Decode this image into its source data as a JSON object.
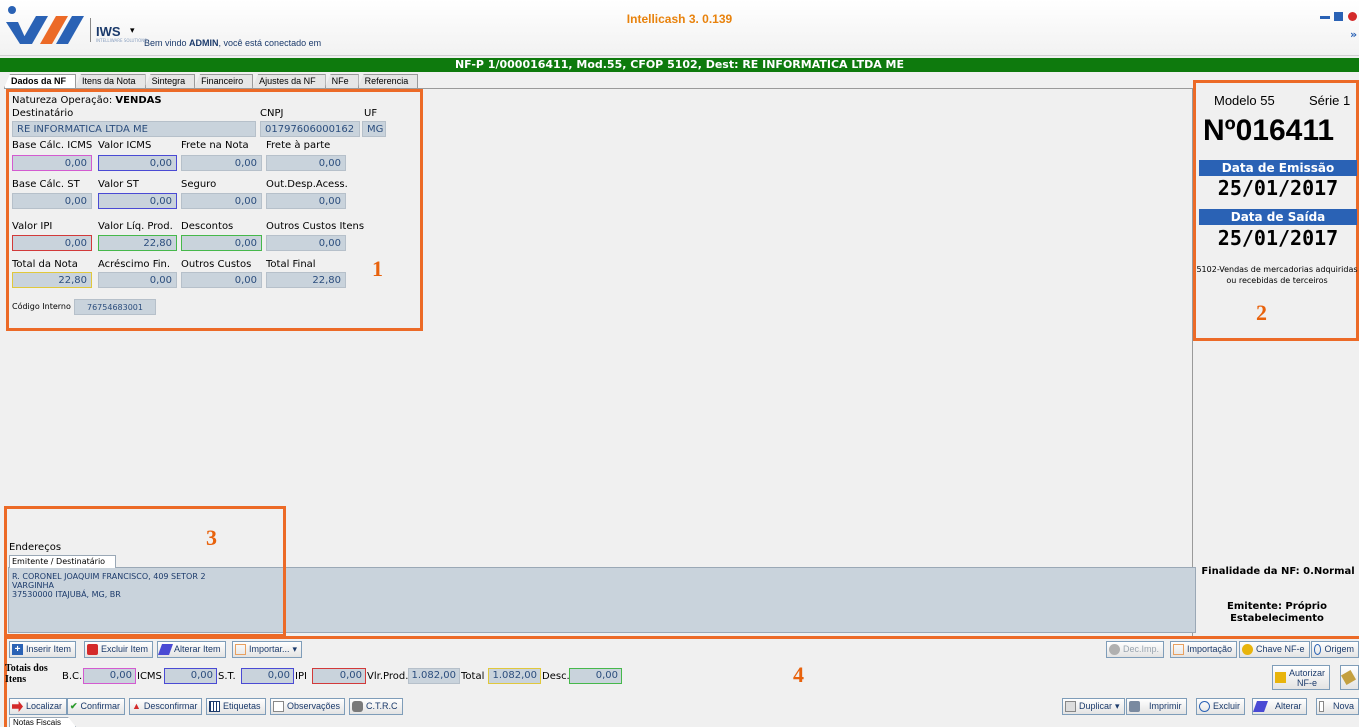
{
  "app": {
    "brand": "IWS",
    "brand_sub": "INTELLIWARE SOLUTIONS",
    "welcome_prefix": "Bem vindo ",
    "welcome_user": "ADMIN",
    "welcome_suffix": ", você está conectado em",
    "title": "Intellicash 3. 0.139"
  },
  "nf_header": "NF-P 1/000016411, Mod.55, CFOP 5102, Dest: RE INFORMATICA LTDA ME",
  "tabs": [
    "Dados da NF",
    "Itens da Nota",
    "Sintegra",
    "Financeiro",
    "Ajustes da NF",
    "NFe",
    "Referencia"
  ],
  "dados": {
    "natureza_label": "Natureza Operação:",
    "natureza_value": "VENDAS",
    "destinatario_label": "Destinatário",
    "destinatario_value": "RE INFORMATICA LTDA ME",
    "cnpj_label": "CNPJ",
    "cnpj_value": "01797606000162",
    "uf_label": "UF",
    "uf_value": "MG",
    "row1": [
      {
        "label": "Base Cálc. ICMS",
        "value": "0,00"
      },
      {
        "label": "Valor ICMS",
        "value": "0,00"
      },
      {
        "label": "Frete na Nota",
        "value": "0,00"
      },
      {
        "label": "Frete à parte",
        "value": "0,00"
      }
    ],
    "row2": [
      {
        "label": "Base Cálc. ST",
        "value": "0,00"
      },
      {
        "label": "Valor ST",
        "value": "0,00"
      },
      {
        "label": "Seguro",
        "value": "0,00"
      },
      {
        "label": "Out.Desp.Acess.",
        "value": "0,00"
      }
    ],
    "row3": [
      {
        "label": "Valor IPI",
        "value": "0,00"
      },
      {
        "label": "Valor Líq. Prod.",
        "value": "22,80"
      },
      {
        "label": "Descontos",
        "value": "0,00"
      },
      {
        "label": "Outros Custos Itens",
        "value": "0,00"
      }
    ],
    "row4": [
      {
        "label": "Total da Nota",
        "value": "22,80"
      },
      {
        "label": "Acréscimo Fin.",
        "value": "0,00"
      },
      {
        "label": "Outros Custos",
        "value": "0,00"
      },
      {
        "label": "Total Final",
        "value": "22,80"
      }
    ],
    "codigo_label": "Código Interno",
    "codigo_value": "76754683001"
  },
  "annotations": [
    "1",
    "2",
    "3",
    "4"
  ],
  "side": {
    "modelo": "Modelo 55",
    "serie": "Série 1",
    "numero": "Nº016411",
    "emissao_label": "Data de Emissão",
    "emissao_value": "25/01/2017",
    "saida_label": "Data de Saída",
    "saida_value": "25/01/2017",
    "cfop_desc": "5102-Vendas de mercadorias adquiridas ou recebidas de terceiros",
    "finalidade": "Finalidade da NF: 0.Normal",
    "emitente": "Emitente: Próprio Estabelecimento"
  },
  "enderecos": {
    "title": "Endereços",
    "tab": "Emitente / Destinatário",
    "line1": "R. CORONEL JOAQUIM FRANCISCO, 409 SETOR 2",
    "line2": "VARGINHA",
    "line3": "37530000 ITAJUBÁ, MG, BR"
  },
  "toolbar1": {
    "inserir": "Inserir Item",
    "excluir": "Excluir Item",
    "alterar": "Alterar Item",
    "importar": "Importar...",
    "dec_imp": "Dec.Imp.",
    "importacao": "Importação",
    "chave": "Chave NF-e",
    "origem": "Origem"
  },
  "totais": {
    "title": "Totais dos Itens",
    "bc_label": "B.C.",
    "bc_value": "0,00",
    "icms_label": "ICMS",
    "icms_value": "0,00",
    "st_label": "S.T.",
    "st_value": "0,00",
    "ipi_label": "IPI",
    "ipi_value": "0,00",
    "vlrprod_label": "Vlr.Prod.",
    "vlrprod_value": "1.082,00",
    "total_label": "Total",
    "total_value": "1.082,00",
    "desc_label": "Desc.",
    "desc_value": "0,00",
    "autorizar": "Autorizar NF-e"
  },
  "toolbar2": {
    "localizar": "Localizar",
    "confirmar": "Confirmar",
    "desconfirmar": "Desconfirmar",
    "etiquetas": "Etiquetas",
    "observacoes": "Observações",
    "ctrc": "C.T.R.C",
    "duplicar": "Duplicar",
    "imprimir": "Imprimir",
    "excluir": "Excluir",
    "alterar": "Alterar",
    "nova": "Nova"
  },
  "bottom_tab": "Notas Fiscais",
  "colors": {
    "accent_orange": "#ec6a27",
    "header_green": "#0e7a0d",
    "side_blue": "#2a62b5",
    "title_orange": "#e8820c"
  }
}
